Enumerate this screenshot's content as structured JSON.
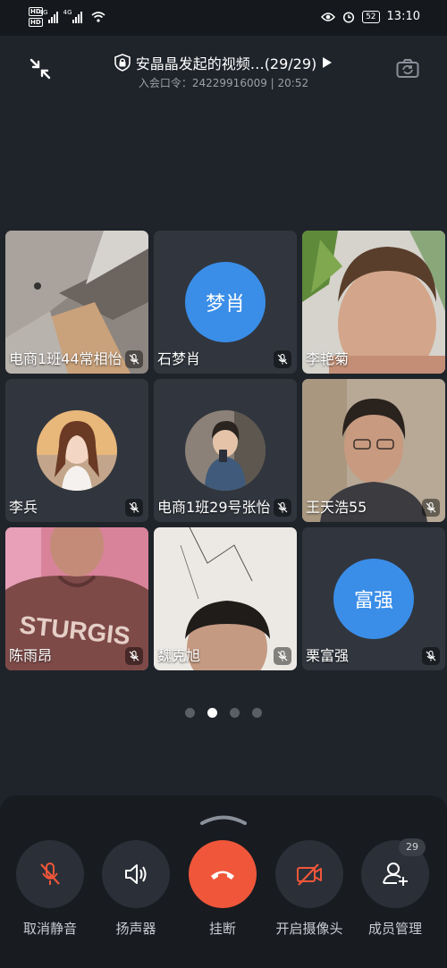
{
  "status_bar": {
    "network_a": "4G",
    "network_b": "4G",
    "battery": "52",
    "time": "13:10"
  },
  "meeting": {
    "title": "安晶晶发起的视频…(29/29)",
    "subtitle": "入会口令：24229916009 | 20:52"
  },
  "participants": [
    {
      "name": "电商1班44常相怡",
      "type": "video",
      "muted": true
    },
    {
      "name": "石梦肖",
      "type": "initials",
      "initials": "梦肖",
      "muted": true
    },
    {
      "name": "李艳菊",
      "type": "video",
      "muted": false
    },
    {
      "name": "李兵",
      "type": "photo",
      "muted": true
    },
    {
      "name": "电商1班29号张怡",
      "type": "photo",
      "muted": true
    },
    {
      "name": "王天浩55",
      "type": "video",
      "muted": true
    },
    {
      "name": "陈雨昂",
      "type": "video",
      "muted": true
    },
    {
      "name": "魏克旭",
      "type": "video",
      "muted": true
    },
    {
      "name": "栗富强",
      "type": "initials",
      "initials": "富强",
      "muted": true
    }
  ],
  "pager": {
    "count": 4,
    "active": 1
  },
  "controls": {
    "unmute": "取消静音",
    "speaker": "扬声器",
    "hangup": "挂断",
    "camera": "开启摄像头",
    "members": "成员管理",
    "member_count": "29"
  },
  "colors": {
    "background": "#1f232a",
    "tile": "#31363e",
    "avatar_blue": "#3a8ee8",
    "hangup_red": "#f0563a",
    "muted_orange": "#f0563a"
  }
}
